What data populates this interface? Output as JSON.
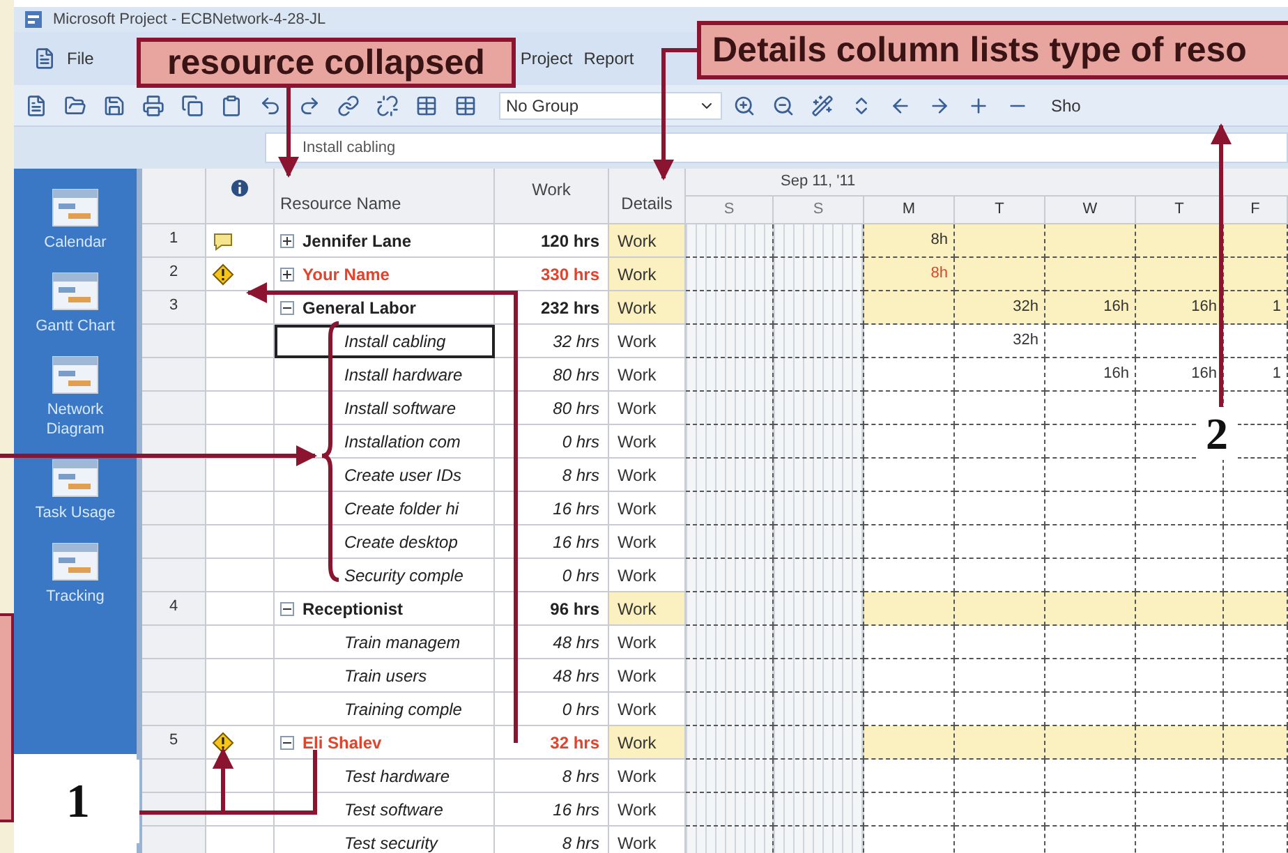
{
  "window": {
    "title": "Microsoft Project - ECBNetwork-4-28-JL"
  },
  "menu": [
    "File",
    "Project",
    "Report"
  ],
  "toolbar": {
    "group_dropdown": "No Group",
    "cut_label": "Sho"
  },
  "entry_bar": {
    "value": "Install cabling"
  },
  "view_bar": [
    {
      "label": "Calendar"
    },
    {
      "label": "Gantt Chart"
    },
    {
      "label": "Network Diagram"
    },
    {
      "label": "Task Usage"
    },
    {
      "label": "Tracking"
    }
  ],
  "table": {
    "columns": [
      "Resource Name",
      "Work",
      "Details"
    ],
    "timescale": {
      "week": "Sep 11, '11",
      "days": [
        {
          "label": "S",
          "weekend": true
        },
        {
          "label": "S",
          "weekend": true
        },
        {
          "label": "M",
          "weekend": false
        },
        {
          "label": "T",
          "weekend": false
        },
        {
          "label": "W",
          "weekend": false
        },
        {
          "label": "T",
          "weekend": false
        },
        {
          "label": "F",
          "weekend": false
        }
      ]
    },
    "rows": [
      {
        "kind": "resource",
        "number": "1",
        "has_note": true,
        "name": "Jennifer Lane",
        "work": "120 hrs",
        "details": "Work",
        "expanded": false,
        "overallocated": false,
        "selected": false,
        "cells": [
          null,
          null,
          "8h",
          null,
          null,
          null,
          null
        ]
      },
      {
        "kind": "resource",
        "number": "2",
        "has_note": false,
        "name": "Your Name",
        "work": "330 hrs",
        "details": "Work",
        "expanded": false,
        "overallocated": true,
        "selected": false,
        "cells": [
          null,
          null,
          "8h",
          null,
          null,
          null,
          null
        ]
      },
      {
        "kind": "resource",
        "number": "3",
        "has_note": false,
        "name": "General Labor",
        "work": "232 hrs",
        "details": "Work",
        "expanded": true,
        "overallocated": false,
        "selected": false,
        "cells": [
          null,
          null,
          null,
          "32h",
          "16h",
          "16h",
          "1"
        ],
        "children": [
          {
            "kind": "assignment",
            "name": "Install cabling",
            "work": "32 hrs",
            "details": "Work",
            "selected": true,
            "cells": [
              null,
              null,
              null,
              "32h",
              null,
              null,
              null
            ]
          },
          {
            "kind": "assignment",
            "name": "Install hardware",
            "work": "80 hrs",
            "details": "Work",
            "selected": false,
            "cells": [
              null,
              null,
              null,
              null,
              "16h",
              "16h",
              "1"
            ]
          },
          {
            "kind": "assignment",
            "name": "Install software",
            "work": "80 hrs",
            "details": "Work",
            "selected": false,
            "cells": [
              null,
              null,
              null,
              null,
              null,
              null,
              null
            ]
          },
          {
            "kind": "assignment",
            "name": "Installation com",
            "work": "0 hrs",
            "details": "Work",
            "selected": false,
            "cells": [
              null,
              null,
              null,
              null,
              null,
              null,
              null
            ]
          },
          {
            "kind": "assignment",
            "name": "Create user IDs",
            "work": "8 hrs",
            "details": "Work",
            "selected": false,
            "cells": [
              null,
              null,
              null,
              null,
              null,
              null,
              null
            ]
          },
          {
            "kind": "assignment",
            "name": "Create folder hi",
            "work": "16 hrs",
            "details": "Work",
            "selected": false,
            "cells": [
              null,
              null,
              null,
              null,
              null,
              null,
              null
            ]
          },
          {
            "kind": "assignment",
            "name": "Create desktop",
            "work": "16 hrs",
            "details": "Work",
            "selected": false,
            "cells": [
              null,
              null,
              null,
              null,
              null,
              null,
              null
            ]
          },
          {
            "kind": "assignment",
            "name": "Security comple",
            "work": "0 hrs",
            "details": "Work",
            "selected": false,
            "cells": [
              null,
              null,
              null,
              null,
              null,
              null,
              null
            ]
          }
        ]
      },
      {
        "kind": "resource",
        "number": "4",
        "has_note": false,
        "name": "Receptionist",
        "work": "96 hrs",
        "details": "Work",
        "expanded": true,
        "overallocated": false,
        "selected": false,
        "cells": [
          null,
          null,
          null,
          null,
          null,
          null,
          null
        ],
        "children": [
          {
            "kind": "assignment",
            "name": "Train managem",
            "work": "48 hrs",
            "details": "Work",
            "selected": false,
            "cells": [
              null,
              null,
              null,
              null,
              null,
              null,
              null
            ]
          },
          {
            "kind": "assignment",
            "name": "Train users",
            "work": "48 hrs",
            "details": "Work",
            "selected": false,
            "cells": [
              null,
              null,
              null,
              null,
              null,
              null,
              null
            ]
          },
          {
            "kind": "assignment",
            "name": "Training comple",
            "work": "0 hrs",
            "details": "Work",
            "selected": false,
            "cells": [
              null,
              null,
              null,
              null,
              null,
              null,
              null
            ]
          }
        ]
      },
      {
        "kind": "resource",
        "number": "5",
        "has_note": false,
        "name": "Eli Shalev",
        "work": "32 hrs",
        "details": "Work",
        "expanded": true,
        "overallocated": true,
        "selected": false,
        "cells": [
          null,
          null,
          null,
          null,
          null,
          null,
          null
        ],
        "children": [
          {
            "kind": "assignment",
            "name": "Test hardware",
            "work": "8 hrs",
            "details": "Work",
            "selected": false,
            "cells": [
              null,
              null,
              null,
              null,
              null,
              null,
              null
            ]
          },
          {
            "kind": "assignment",
            "name": "Test software",
            "work": "16 hrs",
            "details": "Work",
            "selected": false,
            "cells": [
              null,
              null,
              null,
              null,
              null,
              null,
              null
            ]
          },
          {
            "kind": "assignment",
            "name": "Test security",
            "work": "8 hrs",
            "details": "Work",
            "selected": false,
            "cells": [
              null,
              null,
              null,
              null,
              null,
              null,
              null
            ]
          }
        ]
      }
    ]
  },
  "callouts": [
    {
      "text": "resource collapsed"
    },
    {
      "text": "Details column lists type of reso"
    }
  ],
  "step_labels": [
    "1",
    "2"
  ]
}
